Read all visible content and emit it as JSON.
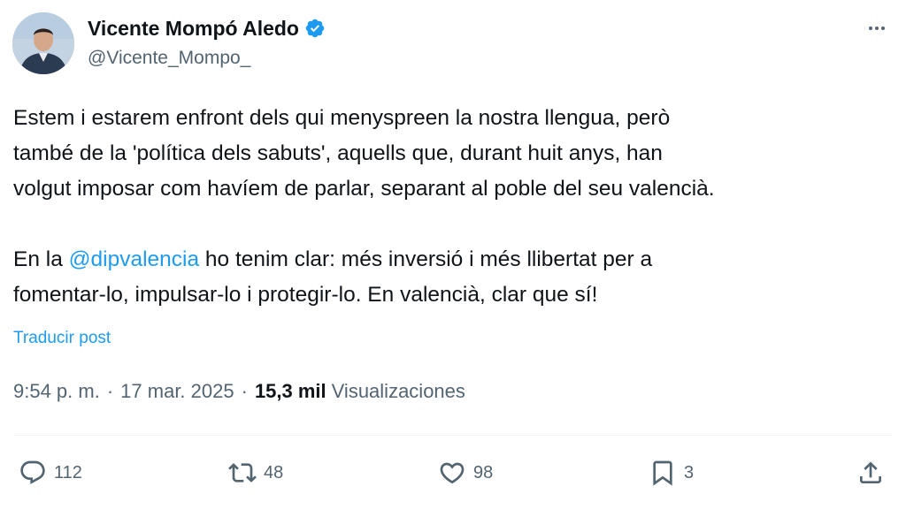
{
  "author": {
    "display_name": "Vicente Mompó Aledo",
    "handle": "@Vicente_Mompo_",
    "verified_icon": "verified-badge-icon"
  },
  "tweet": {
    "paragraph1_lines": [
      "Estem i estarem enfront dels qui menyspreen la nostra llengua, però",
      "també de la 'política dels sabuts', aquells que, durant huit anys, han",
      "volgut imposar com havíem de parlar, separant al poble del seu valencià."
    ],
    "paragraph2_line1_before": "En la ",
    "mention": "@dipvalencia",
    "paragraph2_line1_after": " ho tenim clar: més inversió i més llibertat per a",
    "paragraph2_line2": "fomentar-lo, impulsar-lo i protegir-lo. En valencià, clar que sí!",
    "translate_label": "Traducir post"
  },
  "meta": {
    "time": "9:54 p. m.",
    "separator": "·",
    "date": "17 mar. 2025",
    "views_count": "15,3 mil",
    "views_label": "Visualizaciones"
  },
  "actions": {
    "replies": "112",
    "reposts": "48",
    "likes": "98",
    "bookmarks": "3"
  },
  "colors": {
    "accent": "#1d9bf0",
    "text": "#0f1419",
    "secondary": "#536471"
  }
}
